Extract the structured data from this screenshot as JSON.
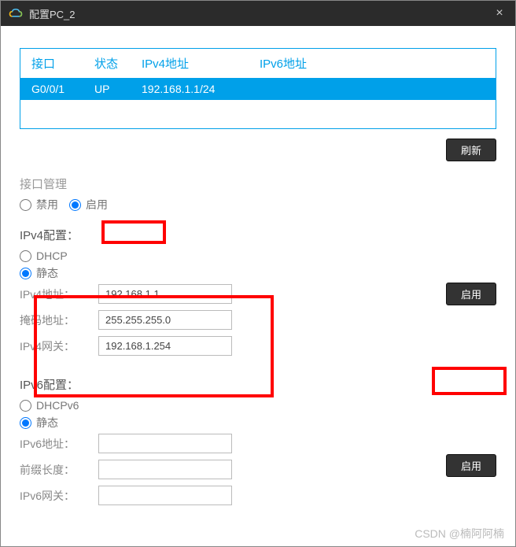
{
  "titlebar": {
    "title": "配置PC_2",
    "close": "×"
  },
  "table": {
    "headers": {
      "interface": "接口",
      "state": "状态",
      "ipv4": "IPv4地址",
      "ipv6": "IPv6地址"
    },
    "row": {
      "interface": "G0/0/1",
      "state": "UP",
      "ipv4": "192.168.1.1/24",
      "ipv6": ""
    }
  },
  "buttons": {
    "refresh": "刷新",
    "apply_v4": "启用",
    "apply_v6": "启用"
  },
  "mgmt": {
    "title": "接口管理",
    "disable": "禁用",
    "enable": "启用"
  },
  "ipv4": {
    "title": "IPv4配置：",
    "dhcp": "DHCP",
    "static": "静态",
    "addr_label": "IPv4地址：",
    "mask_label": "掩码地址：",
    "gw_label": "IPv4网关：",
    "addr": "192.168.1.1",
    "mask": "255.255.255.0",
    "gw": "192.168.1.254"
  },
  "ipv6": {
    "title": "IPv6配置：",
    "dhcpv6": "DHCPv6",
    "static": "静态",
    "addr_label": "IPv6地址：",
    "prefix_label": "前缀长度：",
    "gw_label": "IPv6网关：",
    "addr": "",
    "prefix": "",
    "gw": ""
  },
  "watermark": "CSDN @楠阿阿楠"
}
